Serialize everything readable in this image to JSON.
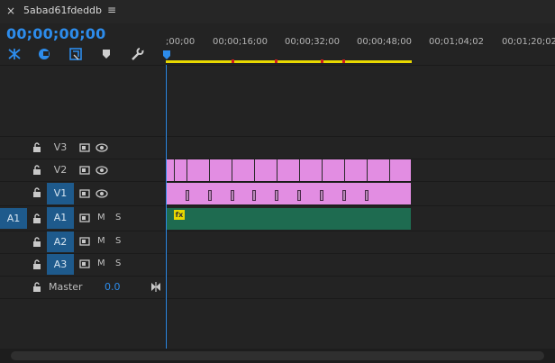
{
  "tab": {
    "title": "5abad61fdeddb"
  },
  "timecode": "00;00;00;00",
  "tools": [
    "snap-magnet-icon",
    "linked-selection-icon",
    "insert-sequence-icon",
    "add-marker-icon",
    "wrench-icon"
  ],
  "ruler": {
    "labels": [
      ";00;00",
      "00;00;16;00",
      "00;00;32;00",
      "00;00;48;00",
      "00;01;04;02",
      "00;01;20;02"
    ]
  },
  "tracks": {
    "video": [
      {
        "label": "V3",
        "targeted": false
      },
      {
        "label": "V2",
        "targeted": false
      },
      {
        "label": "V1",
        "targeted": true
      }
    ],
    "audio": [
      {
        "label": "A1",
        "source": "A1",
        "targeted": true,
        "mute": "M",
        "solo": "S"
      },
      {
        "label": "A2",
        "targeted": true,
        "mute": "M",
        "solo": "S"
      },
      {
        "label": "A3",
        "targeted": true,
        "mute": "M",
        "solo": "S"
      }
    ],
    "master": {
      "label": "Master",
      "value": "0.0"
    }
  },
  "audio_clip": {
    "fx_badge": "fx"
  },
  "colors": {
    "accent": "#2d8ceb",
    "video_clip": "#e28de2",
    "audio_clip": "#1e6b50",
    "work_area": "#e8d800",
    "marker": "#d02020"
  }
}
